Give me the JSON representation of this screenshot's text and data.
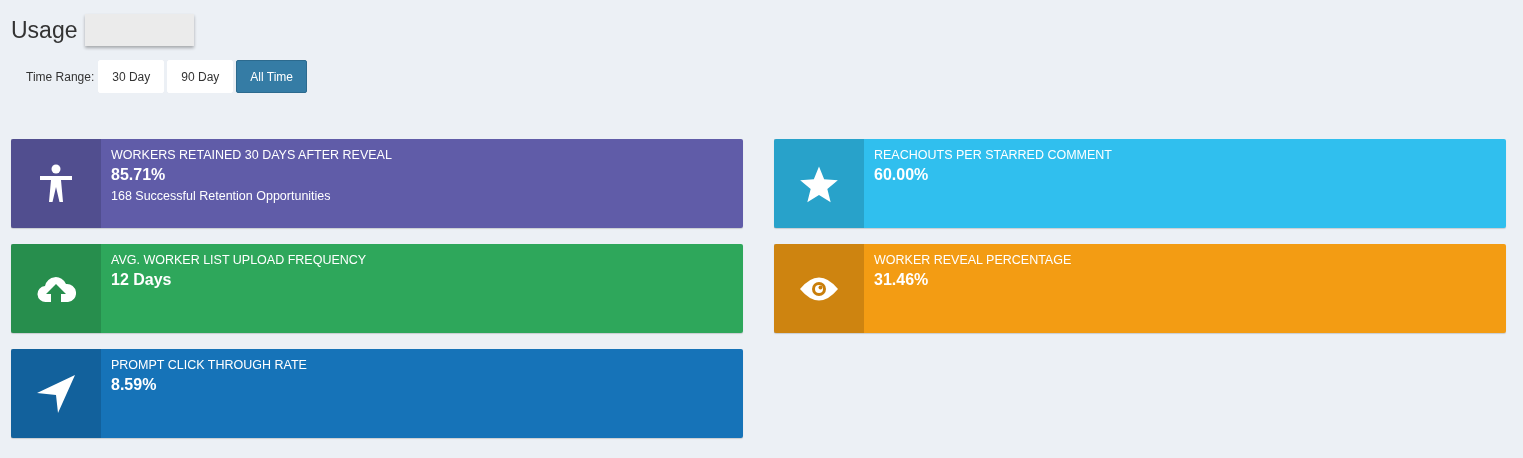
{
  "title": "Usage",
  "time_range": {
    "label": "Time Range:",
    "options": [
      {
        "label": "30 Day",
        "selected": false
      },
      {
        "label": "90 Day",
        "selected": false
      },
      {
        "label": "All Time",
        "selected": true
      }
    ]
  },
  "cards": [
    {
      "kind": "person",
      "color": "#605ca8",
      "title": "WORKERS RETAINED 30 DAYS AFTER REVEAL",
      "value": "85.71%",
      "note": "168 Successful Retention Opportunities"
    },
    {
      "kind": "star",
      "color": "#30bfee",
      "title": "REACHOUTS PER STARRED COMMENT",
      "value": "60.00%"
    },
    {
      "kind": "upload",
      "color": "#2ea75b",
      "title": "AVG. WORKER LIST UPLOAD FREQUENCY",
      "value": "12 Days"
    },
    {
      "kind": "eye",
      "color": "#f39c13",
      "title": "WORKER REVEAL PERCENTAGE",
      "value": "31.46%"
    },
    {
      "kind": "pointer",
      "color": "#1673b8",
      "title": "PROMPT CLICK THROUGH RATE",
      "value": "8.59%"
    }
  ]
}
